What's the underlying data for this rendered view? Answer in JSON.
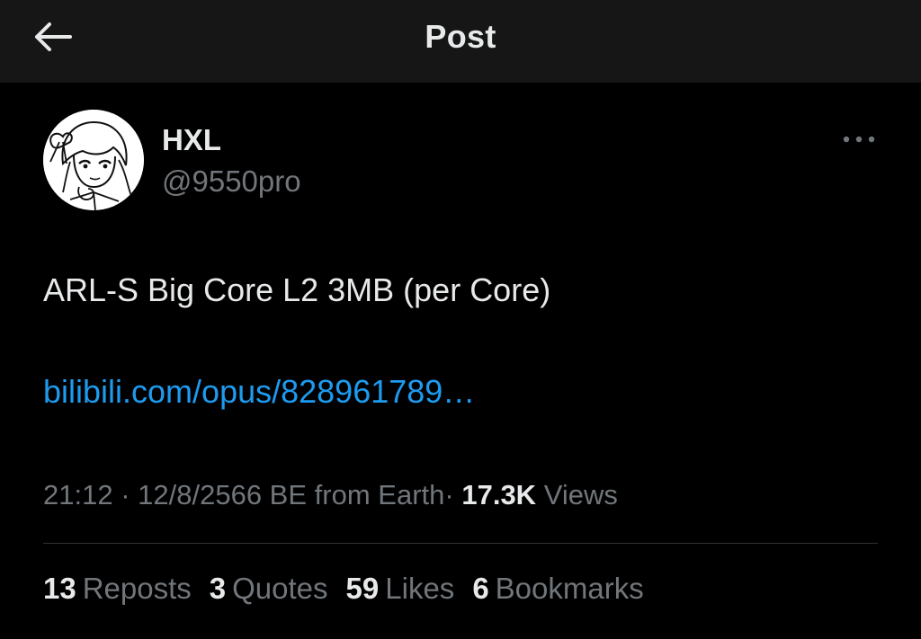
{
  "header": {
    "title": "Post",
    "back_icon": "back-arrow-icon"
  },
  "post": {
    "author": {
      "display_name": "HXL",
      "handle": "@9550pro",
      "avatar": "anime-sketch-avatar"
    },
    "more_icon": "more-dots-icon",
    "text": "ARL-S Big Core L2 3MB (per Core)",
    "link": "bilibili.com/opus/828961789…",
    "meta": {
      "time": "21:12",
      "separator": "·",
      "date": "12/8/2566 BE",
      "source": "from Earth",
      "views_count": "17.3K",
      "views_label": "Views"
    },
    "stats": [
      {
        "count": "13",
        "label": "Reposts"
      },
      {
        "count": "3",
        "label": "Quotes"
      },
      {
        "count": "59",
        "label": "Likes"
      },
      {
        "count": "6",
        "label": "Bookmarks"
      }
    ]
  },
  "colors": {
    "background": "#000000",
    "header_bg": "#161616",
    "text_primary": "#e7e9ea",
    "text_secondary": "#71767b",
    "link": "#1d9bf0",
    "divider": "#2f3336"
  }
}
